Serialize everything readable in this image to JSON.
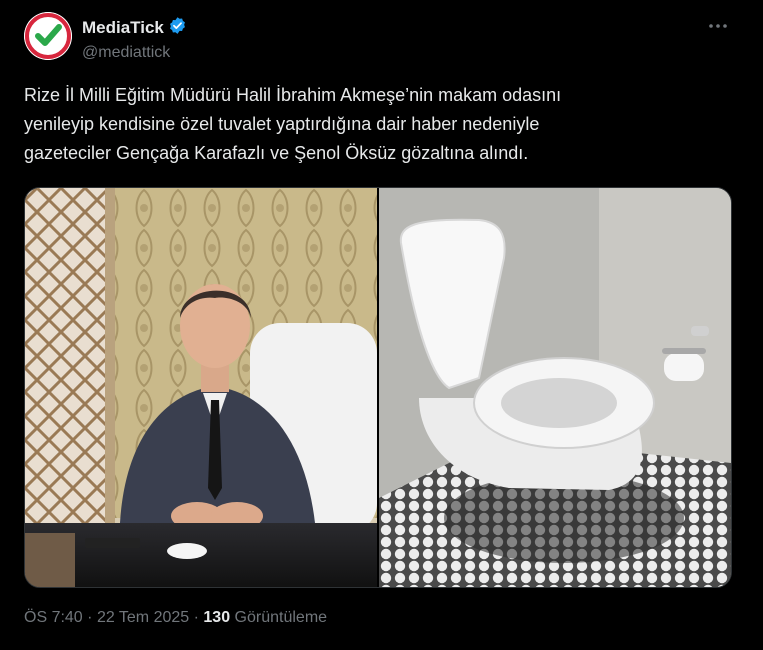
{
  "author": {
    "name": "MediaTick",
    "handle": "@mediattick",
    "verified_icon": "verified-badge-icon",
    "avatar_text": "MEDIATICK",
    "brand_color": "#1d9bf0"
  },
  "more_icon": "more-horizontal-icon",
  "tweet_text": "Rize İl Milli Eğitim Müdürü Halil İbrahim Akmeşe’nin makam odasını\nyenileyip kendisine özel tuvalet yaptırdığına dair haber nedeniyle\ngazeteciler Gençağa Karafazlı ve Şenol Öksüz gözaltına alındı.",
  "media": {
    "left_image": "photo-man-at-desk",
    "right_image": "photo-wall-hung-toilet"
  },
  "meta": {
    "time": "ÖS 7:40",
    "separator": "·",
    "date": "22 Tem 2025",
    "views_count": "130",
    "views_label": "Görüntüleme"
  }
}
